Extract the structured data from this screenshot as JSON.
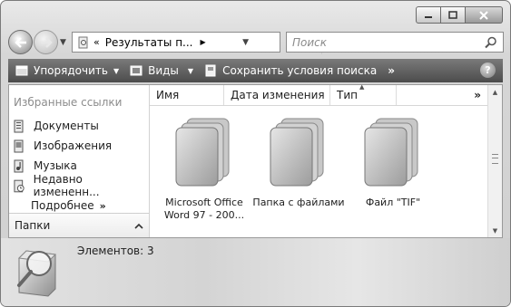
{
  "navigation": {
    "address_prefix": "«",
    "address_path": "Результаты п...",
    "search_placeholder": "Поиск"
  },
  "toolbar": {
    "organize_label": "Упорядочить",
    "views_label": "Виды",
    "save_search_label": "Сохранить условия поиска",
    "more_label": "»",
    "help_label": "?"
  },
  "sidebar": {
    "favorites_header": "Избранные ссылки",
    "items": [
      {
        "label": "Документы",
        "icon": "documents-icon"
      },
      {
        "label": "Изображения",
        "icon": "pictures-icon"
      },
      {
        "label": "Музыка",
        "icon": "music-icon"
      },
      {
        "label": "Недавно измененн...",
        "icon": "recent-icon"
      }
    ],
    "more_label": "Подробнее",
    "folders_label": "Папки"
  },
  "columns": {
    "name": "Имя",
    "date": "Дата изменения",
    "type": "Тип",
    "more": "»"
  },
  "files": [
    {
      "line1": "Microsoft Office",
      "line2": "Word 97 - 200..."
    },
    {
      "line1": "Папка с файлами",
      "line2": ""
    },
    {
      "line1": "Файл \"TIF\"",
      "line2": ""
    }
  ],
  "details": {
    "count_text": "Элементов: 3"
  }
}
